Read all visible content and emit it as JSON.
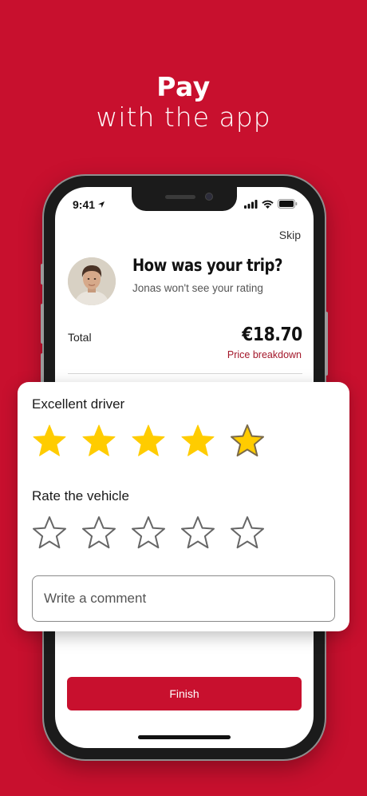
{
  "headline": {
    "line1": "Pay",
    "line2": "with the app"
  },
  "status_bar": {
    "time": "9:41"
  },
  "screen": {
    "skip_label": "Skip",
    "title": "How was your trip?",
    "subtitle": "Jonas won't see your rating",
    "total_label": "Total",
    "total_amount": "€18.70",
    "price_breakdown_label": "Price breakdown",
    "finish_label": "Finish"
  },
  "rating_card": {
    "driver_label": "Excellent driver",
    "driver_rating": 5,
    "vehicle_label": "Rate the vehicle",
    "vehicle_rating": 0,
    "max_stars": 5,
    "comment_placeholder": "Write a comment"
  },
  "colors": {
    "brand_red": "#c8102e",
    "star_filled": "#ffcc00",
    "price_link": "#a3172a"
  },
  "icons": [
    "location-arrow-icon",
    "signal-icon",
    "wifi-icon",
    "battery-icon",
    "star-icon"
  ]
}
